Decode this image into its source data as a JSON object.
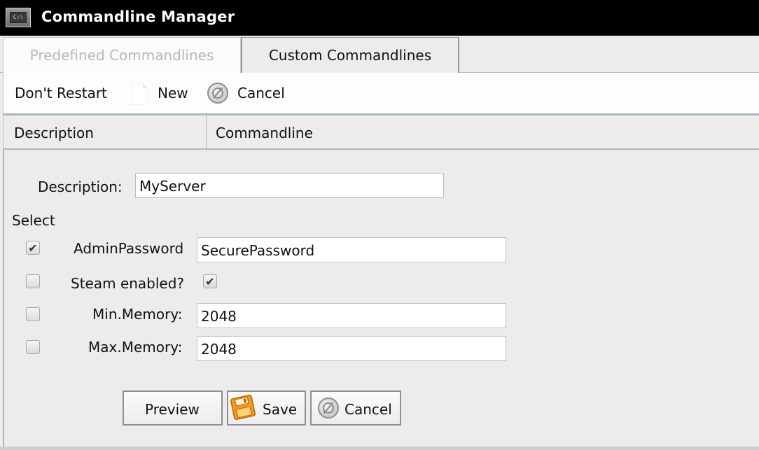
{
  "window": {
    "title": "Commandline Manager",
    "icon": "console-icon",
    "icon_text": "C:\\"
  },
  "tabs": [
    {
      "label": "Predefined Commandlines",
      "active": false
    },
    {
      "label": "Custom Commandlines",
      "active": true
    }
  ],
  "toolbar": {
    "restart_label": "Don't Restart",
    "new_label": "New",
    "cancel_label": "Cancel",
    "icons": [
      "new-document-icon",
      "cancel-icon"
    ]
  },
  "table_header": {
    "columns": [
      "Description",
      "Commandline"
    ]
  },
  "form": {
    "description_label": "Description:",
    "description_value": "MyServer",
    "select_label": "Select",
    "options": [
      {
        "select_checked": true,
        "label": "AdminPassword",
        "value": "SecurePassword",
        "type": "text"
      },
      {
        "select_checked": false,
        "label": "Steam enabled?",
        "value_checked": true,
        "type": "checkbox"
      },
      {
        "select_checked": false,
        "label": "Min.Memory:",
        "value": "2048",
        "type": "text"
      },
      {
        "select_checked": false,
        "label": "Max.Memory:",
        "value": "2048",
        "type": "text"
      }
    ],
    "buttons": {
      "preview_label": "Preview",
      "save_label": "Save",
      "cancel_label": "Cancel"
    }
  },
  "colors": {
    "titlebar_bg": "#000000",
    "accent_border": "#a9b5c2",
    "save_icon": "#f39a1e"
  }
}
